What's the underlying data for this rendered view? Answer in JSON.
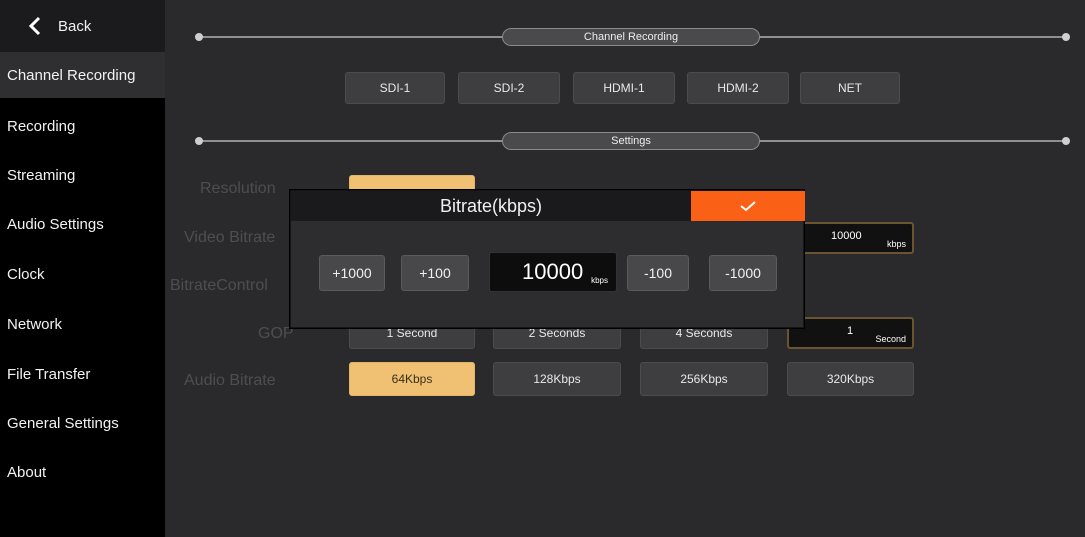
{
  "sidebar": {
    "back_label": "Back",
    "items": [
      {
        "label": "Channel Recording",
        "active": true
      },
      {
        "label": "Recording"
      },
      {
        "label": "Streaming"
      },
      {
        "label": "Audio Settings"
      },
      {
        "label": "Clock"
      },
      {
        "label": "Network"
      },
      {
        "label": "File Transfer"
      },
      {
        "label": "General Settings"
      },
      {
        "label": "About"
      }
    ]
  },
  "sections": {
    "channel_title": "Channel Recording",
    "settings_title": "Settings"
  },
  "channels": [
    "SDI-1",
    "SDI-2",
    "HDMI-1",
    "HDMI-2",
    "NET"
  ],
  "settings": {
    "resolution": {
      "label": "Resolution"
    },
    "video_bitrate": {
      "label": "Video Bitrate",
      "value": "10000",
      "unit": "kbps"
    },
    "bitrate_control": {
      "label": "BitrateControl"
    },
    "gop": {
      "label": "GOP",
      "options": [
        "1 Second",
        "2 Seconds",
        "4 Seconds"
      ],
      "value": "1",
      "unit": "Second"
    },
    "audio_bitrate": {
      "label": "Audio Bitrate",
      "options": [
        "64Kbps",
        "128Kbps",
        "256Kbps",
        "320Kbps"
      ],
      "selected": "64Kbps"
    }
  },
  "modal": {
    "title": "Bitrate(kbps)",
    "buttons": [
      "+1000",
      "+100",
      "-100",
      "-1000"
    ],
    "value": "10000",
    "unit": "kbps",
    "confirm_icon": "check-icon",
    "confirm_color": "#fb6116"
  },
  "colors": {
    "selected": "#f0c173",
    "accent": "#fb6116"
  }
}
